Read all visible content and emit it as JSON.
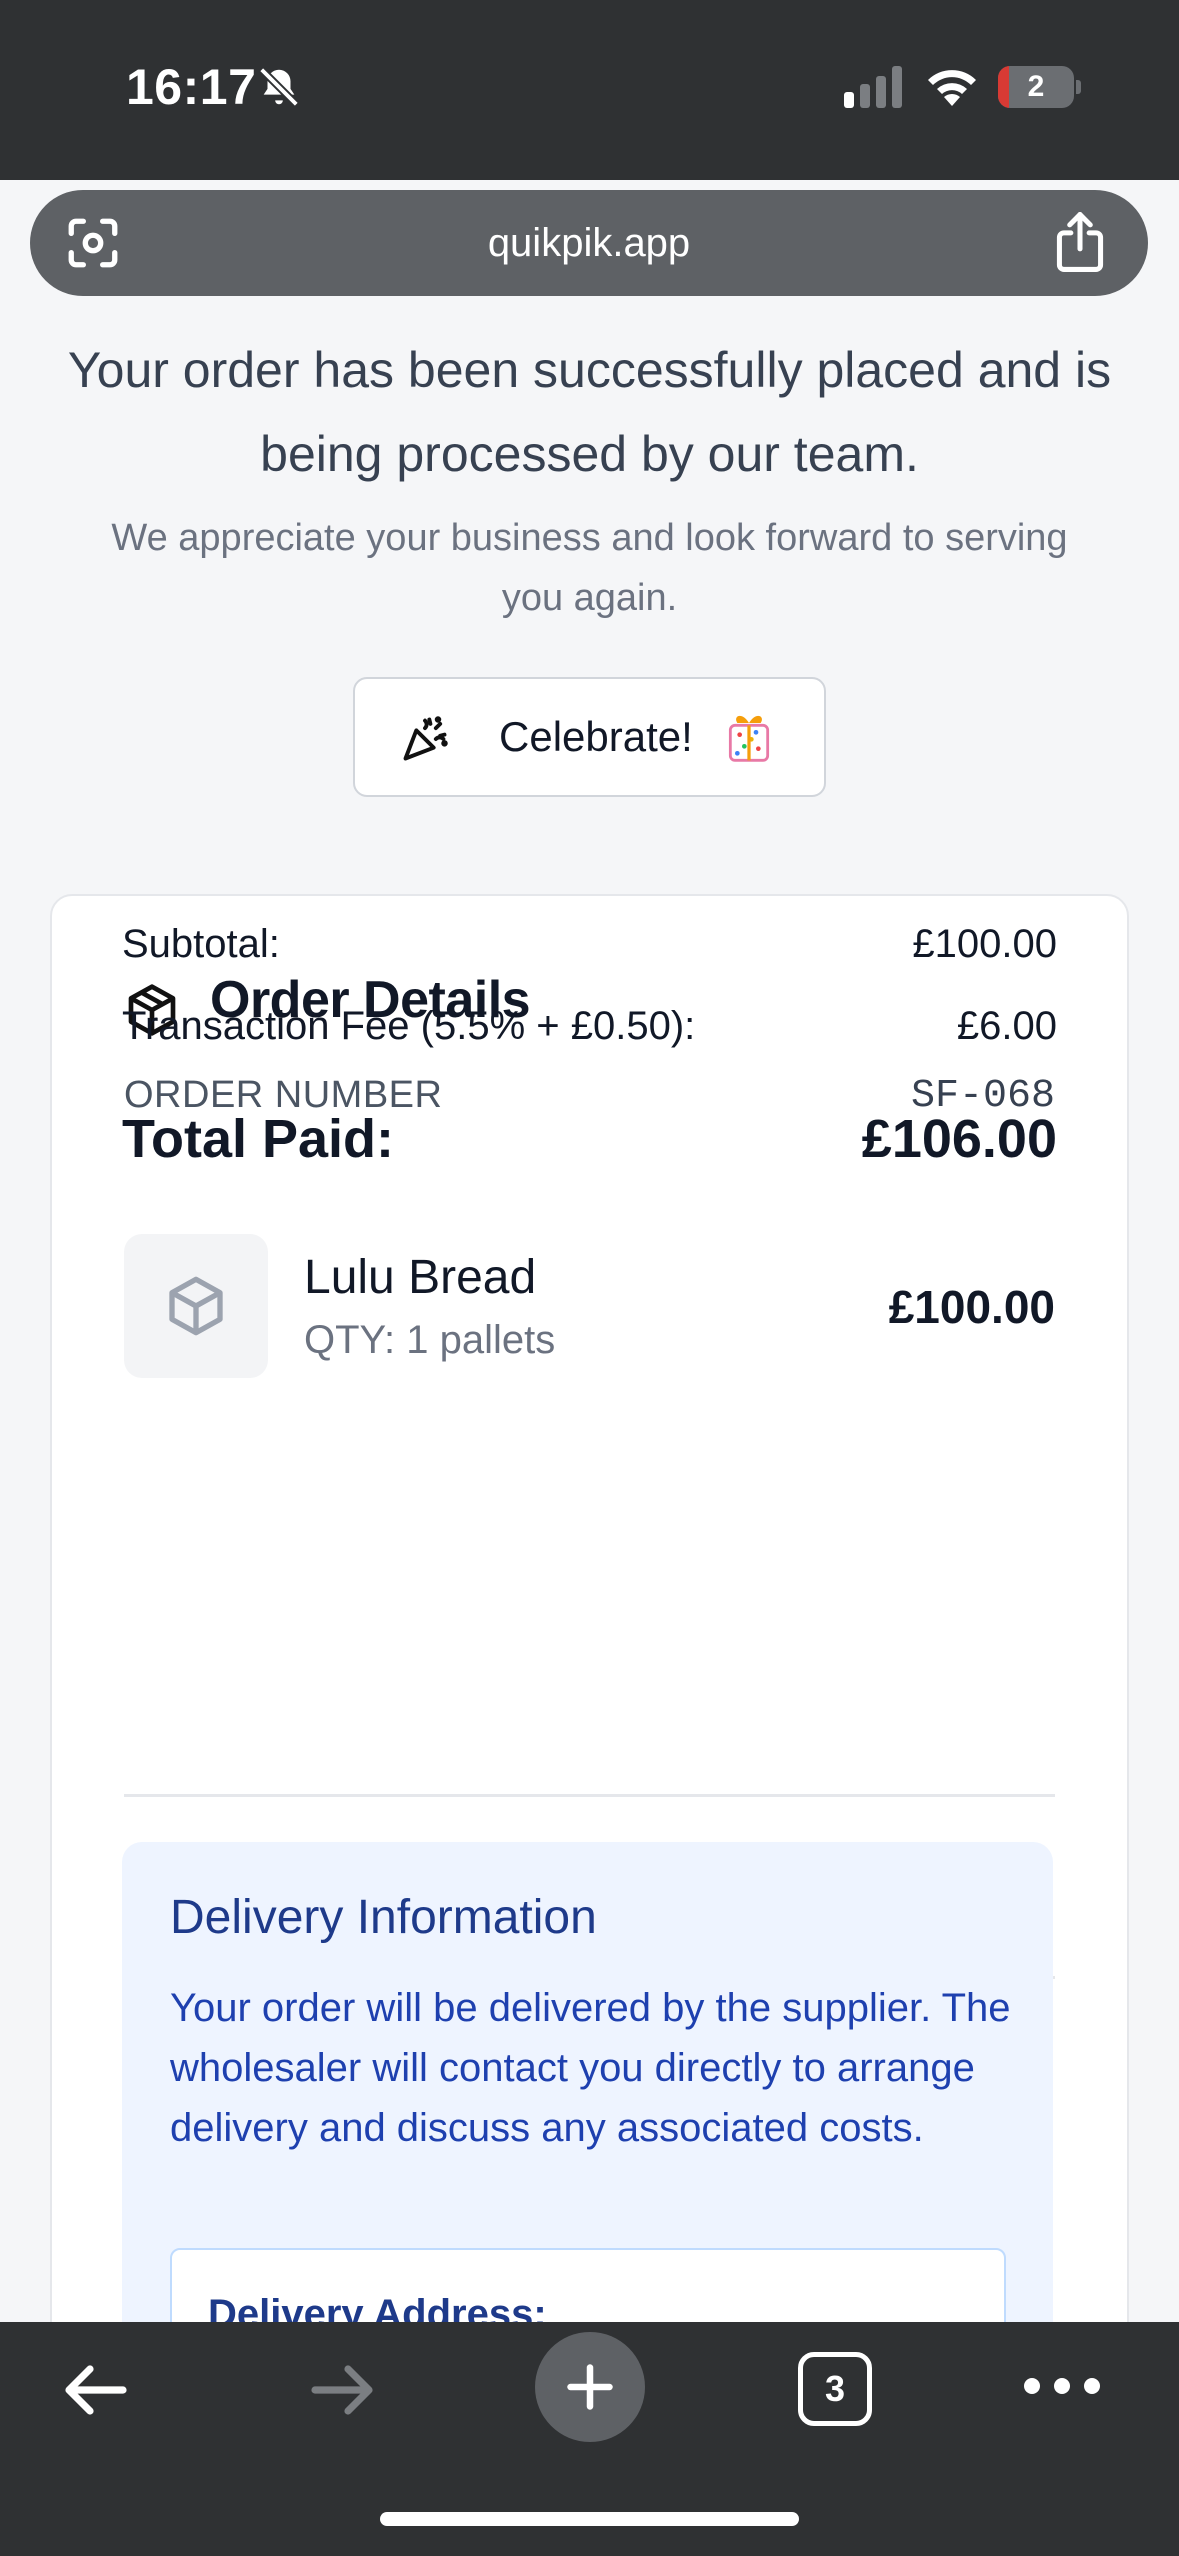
{
  "status_bar": {
    "time": "16:17",
    "battery_level": "2",
    "battery_fraction": 0.15,
    "icons": [
      "bell-slash-icon",
      "cellular-signal-icon",
      "wifi-icon",
      "battery-icon"
    ]
  },
  "browser": {
    "url": "quikpik.app",
    "icons": [
      "screen-scan-icon",
      "share-icon"
    ]
  },
  "confirmation": {
    "headline": "Your order has been successfully placed and is being processed by our team.",
    "subline": "We appreciate your business and look forward to serving you again.",
    "celebrate_label": "Celebrate!"
  },
  "order_details": {
    "title": "Order Details",
    "order_number_label": "ORDER NUMBER",
    "order_number": "SF-068",
    "items": [
      {
        "name": "Lulu Bread",
        "qty": "QTY: 1 pallets",
        "price": "£100.00"
      }
    ],
    "subtotal_label": "Subtotal:",
    "subtotal": "£100.00",
    "fee_label": "Transaction Fee (5.5% + £0.50):",
    "fee": "£6.00",
    "total_label": "Total Paid:",
    "total": "£106.00"
  },
  "delivery": {
    "title": "Delivery Information",
    "text": "Your order will be delivered by the supplier. The wholesaler will contact you directly to arrange delivery and discuss any associated costs.",
    "address_label": "Delivery Address:"
  },
  "toolbar": {
    "tab_count": "3",
    "icons": [
      "back-arrow-icon",
      "forward-arrow-icon",
      "new-tab-plus-icon",
      "tabs-icon",
      "more-icon"
    ]
  },
  "colors": {
    "chrome": "#2f3133",
    "url_bar": "#5e6165",
    "delivery_bg": "#eef4ff",
    "delivery_text": "#1e40af",
    "battery_low": "#d83a34"
  }
}
